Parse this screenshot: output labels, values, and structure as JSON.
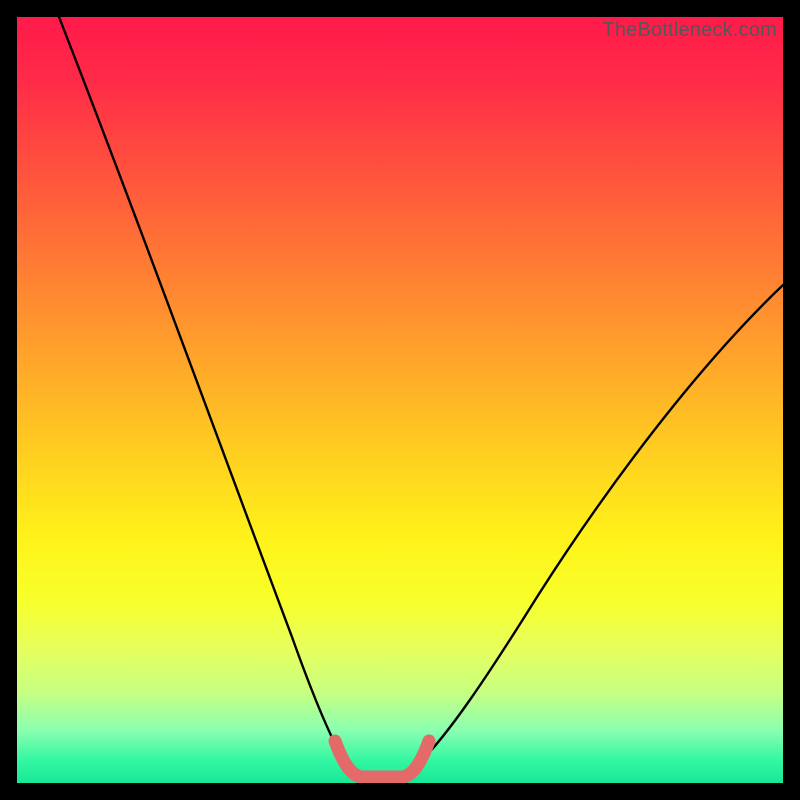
{
  "brand": {
    "text": "TheBottleneck.com"
  },
  "colors": {
    "page_bg": "#000000",
    "gradient_top": "#ff1a4a",
    "gradient_mid": "#fff21a",
    "gradient_bottom": "#18e898",
    "curve_stroke": "#000000",
    "valley_stroke": "#e46a6a"
  },
  "chart_data": {
    "type": "line",
    "title": "",
    "xlabel": "",
    "ylabel": "",
    "ylim": [
      0,
      100
    ],
    "x": [
      0,
      5,
      10,
      15,
      20,
      25,
      30,
      35,
      40,
      42,
      44,
      46,
      48,
      50,
      52,
      55,
      60,
      65,
      70,
      75,
      80,
      85,
      90,
      95,
      100
    ],
    "series": [
      {
        "name": "bottleneck_curve",
        "values": [
          100,
          90,
          80,
          71,
          62,
          53,
          44,
          34,
          20,
          10,
          2,
          0,
          0,
          0,
          2,
          10,
          22,
          31,
          39,
          46,
          52,
          57,
          61,
          64,
          66
        ]
      }
    ],
    "valley_highlight": {
      "x_range": [
        42,
        52
      ],
      "value": 0
    }
  }
}
